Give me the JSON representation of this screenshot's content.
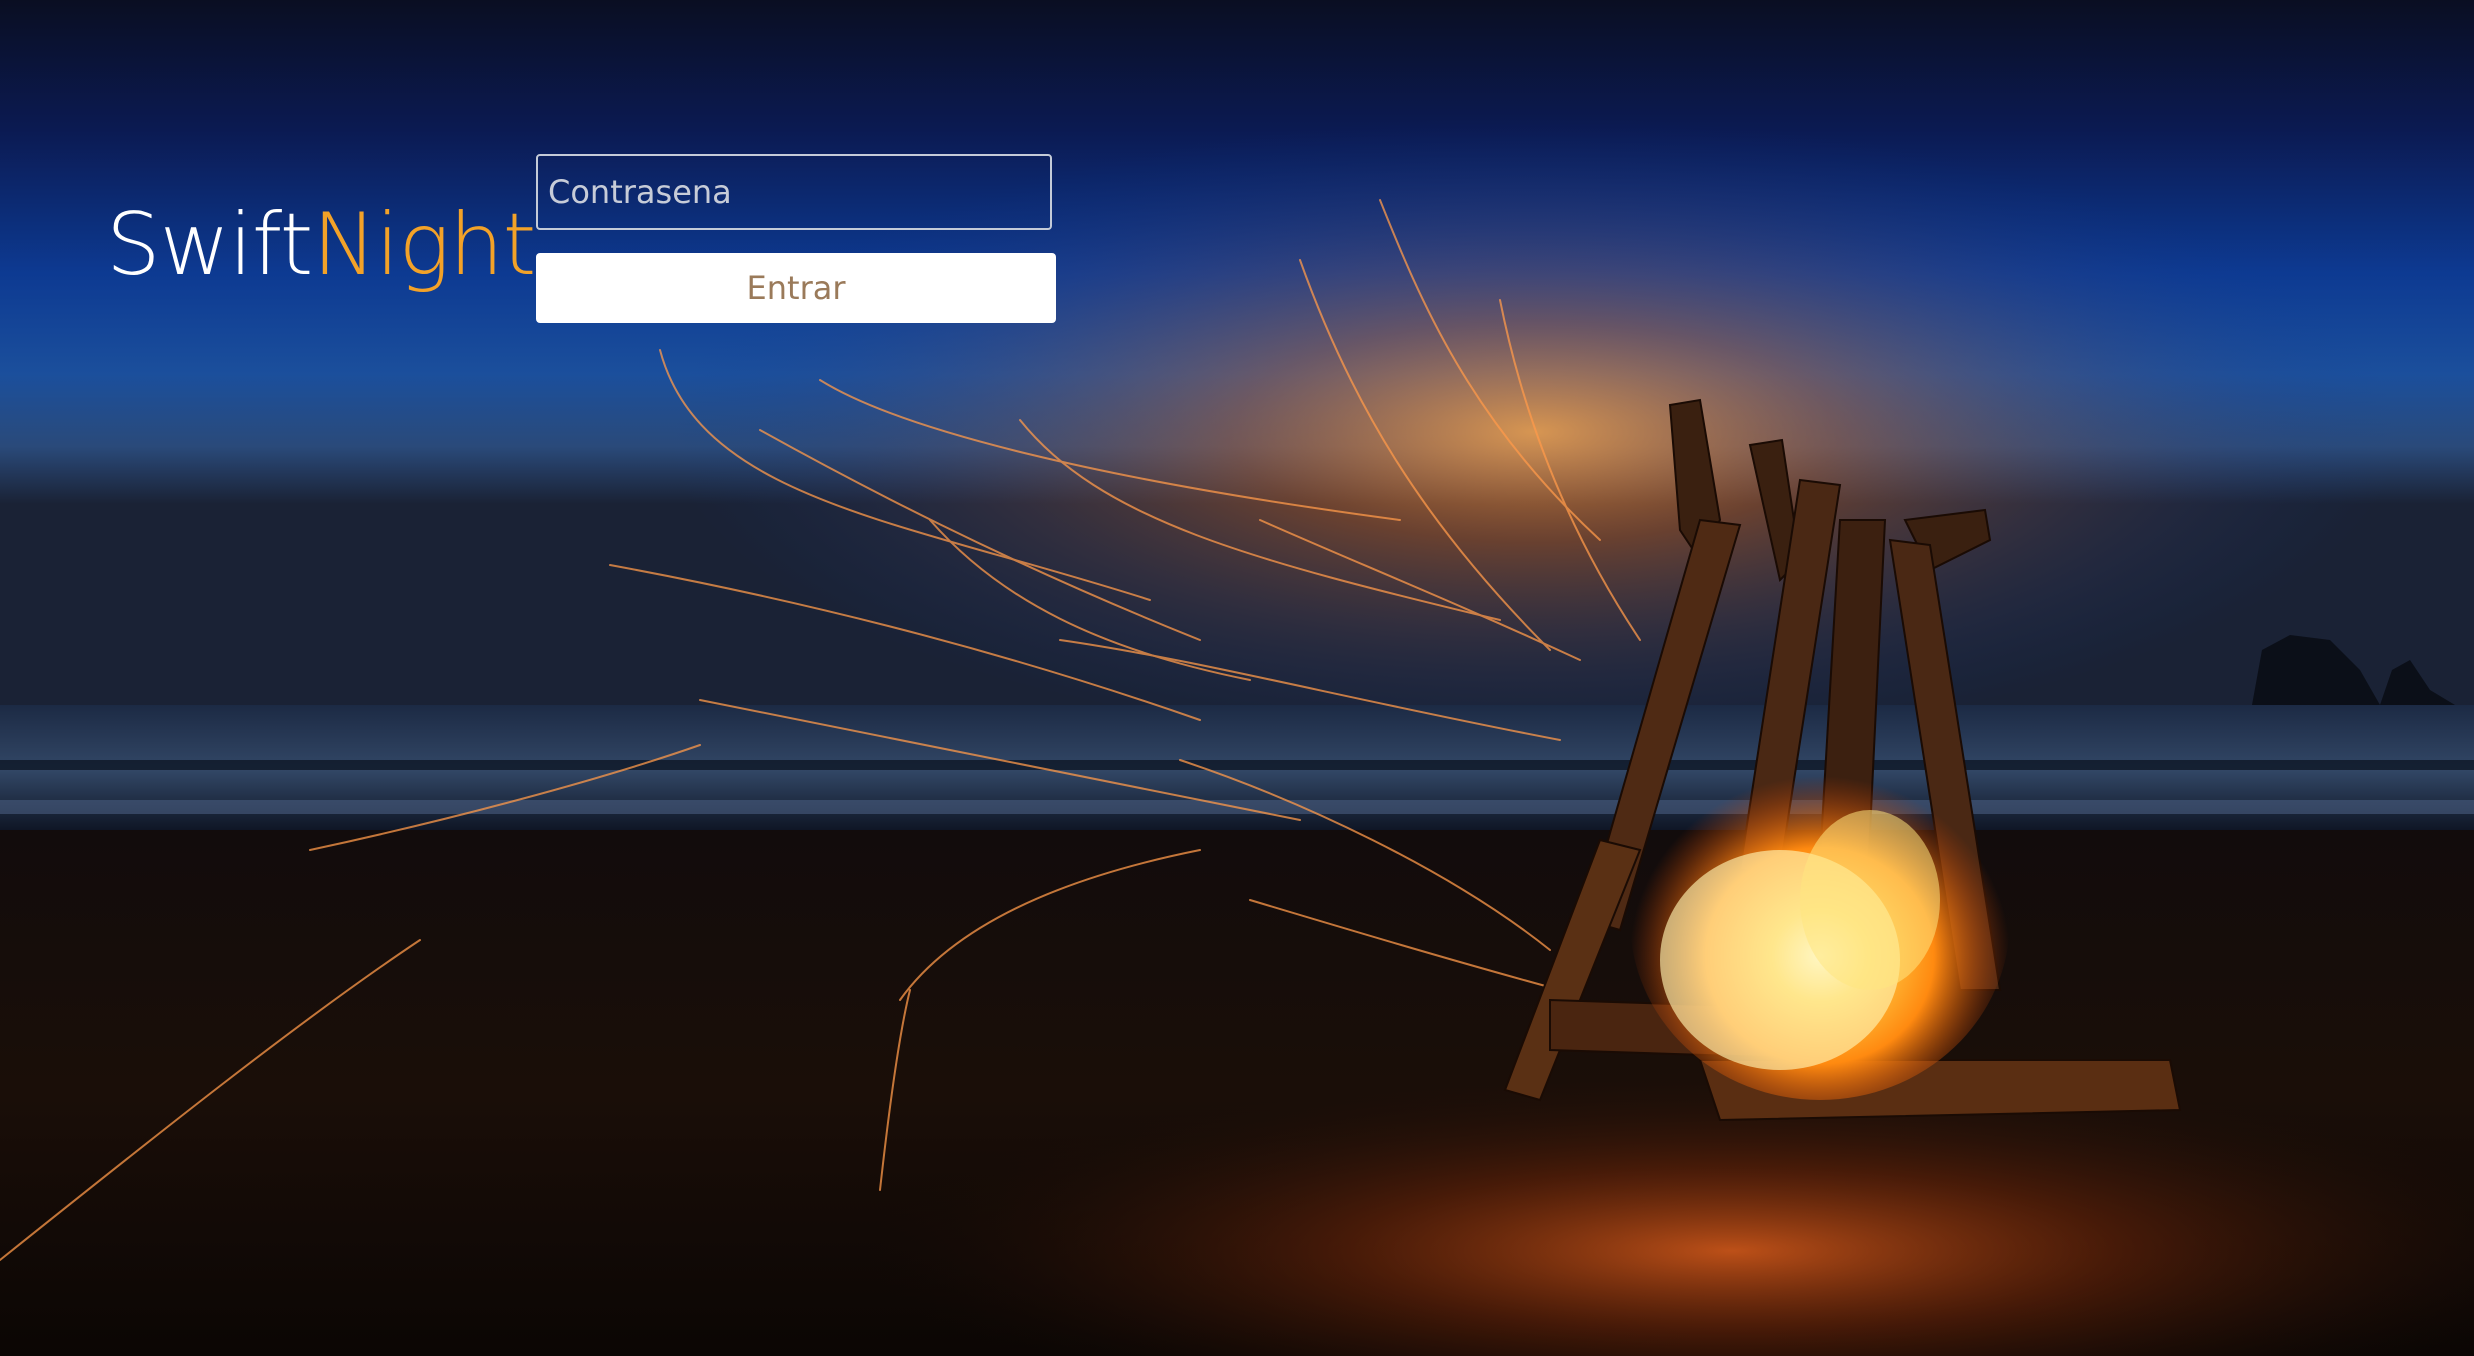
{
  "brand": {
    "part1": "Swift",
    "part2": "Night",
    "color_part1": "#ffffff",
    "color_part2": "#f3a228"
  },
  "login": {
    "password_placeholder": "Contrasena",
    "password_value": "",
    "submit_label": "Entrar"
  },
  "background": {
    "sky_top": "#0a1130",
    "sky_mid": "#0f3f95",
    "horizon_glow": "#f08a2a",
    "sand": "#0b0706",
    "fire": "#ffb020"
  }
}
